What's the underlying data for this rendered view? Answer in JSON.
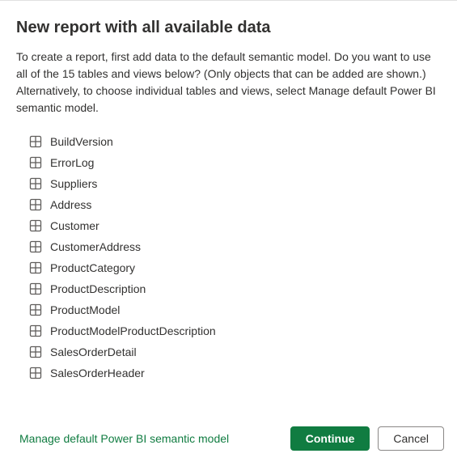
{
  "title": "New report with all available data",
  "description": "To create a report, first add data to the default semantic model. Do you want to use all of the 15 tables and views below? (Only objects that can be added are shown.) Alternatively, to choose individual tables and views, select Manage default Power BI semantic model.",
  "tables": [
    {
      "label": "BuildVersion"
    },
    {
      "label": "ErrorLog"
    },
    {
      "label": "Suppliers"
    },
    {
      "label": "Address"
    },
    {
      "label": "Customer"
    },
    {
      "label": "CustomerAddress"
    },
    {
      "label": "ProductCategory"
    },
    {
      "label": "ProductDescription"
    },
    {
      "label": "ProductModel"
    },
    {
      "label": "ProductModelProductDescription"
    },
    {
      "label": "SalesOrderDetail"
    },
    {
      "label": "SalesOrderHeader"
    }
  ],
  "footer": {
    "manage_link": "Manage default Power BI semantic model",
    "continue": "Continue",
    "cancel": "Cancel"
  }
}
